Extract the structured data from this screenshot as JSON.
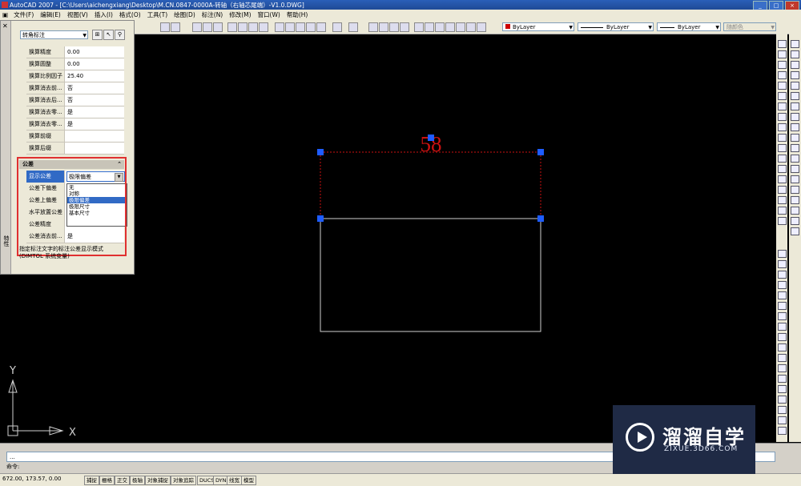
{
  "window": {
    "title": "AutoCAD 2007 - [C:\\Users\\aichengxiang\\Desktop\\M.CN.0847-0000A-转轴（右轴芯尾端）-V1.0.DWG]",
    "min": "_",
    "max": "□",
    "close": "×"
  },
  "menu": [
    "文件(F)",
    "编辑(E)",
    "视图(V)",
    "插入(I)",
    "格式(O)",
    "工具(T)",
    "绘图(D)",
    "标注(N)",
    "修改(M)",
    "窗口(W)",
    "帮助(H)"
  ],
  "toolbar": {
    "color": "ByLayer",
    "linetype": "ByLayer",
    "lineweight": "ByLayer",
    "plotstyle": "随颜色"
  },
  "properties": {
    "object_type": "转角标注",
    "rows": [
      {
        "k": "换算精度",
        "v": "0.00"
      },
      {
        "k": "换算圆整",
        "v": "0.00"
      },
      {
        "k": "换算比例因子",
        "v": "25.40"
      },
      {
        "k": "换算消去前...",
        "v": "否"
      },
      {
        "k": "换算消去后...",
        "v": "否"
      },
      {
        "k": "换算消去零...",
        "v": "是"
      },
      {
        "k": "换算消去零...",
        "v": "是"
      },
      {
        "k": "换算前缀",
        "v": ""
      },
      {
        "k": "换算后缀",
        "v": ""
      }
    ],
    "tolerance": {
      "header": "公差",
      "chevron": "⌃",
      "rows": [
        {
          "k": "显示公差",
          "v": ""
        },
        {
          "k": "公差下偏差",
          "v": ""
        },
        {
          "k": "公差上偏差",
          "v": ""
        },
        {
          "k": "水平放置公差",
          "v": ""
        },
        {
          "k": "公差精度",
          "v": "0.000"
        },
        {
          "k": "公差消去前...",
          "v": "是"
        }
      ],
      "selected": "极限偏差",
      "options": [
        "无",
        "对称",
        "极限偏差",
        "极限尺寸",
        "基本尺寸"
      ],
      "selected_index": 2
    },
    "description": "指定标注文字的标注公差显示模式",
    "sysvar": "(DIMTOL 系统变量)",
    "side_label": "特性"
  },
  "drawing": {
    "dimension_text": "58",
    "ucs_x": "X",
    "ucs_y": "Y"
  },
  "command": {
    "history": "...",
    "prompt": "命令:"
  },
  "status": {
    "coords": "672.00, 173.57, 0.00",
    "buttons": [
      "捕捉",
      "栅格",
      "正交",
      "极轴",
      "对象捕捉",
      "对象追踪",
      "DUCS",
      "DYN",
      "线宽",
      "模型"
    ]
  },
  "watermark": {
    "text": "溜溜自学",
    "url": "ZIXUE.3D66.COM"
  },
  "colors": {
    "background": "#000000",
    "selection_grip": "#1e5cff",
    "dimension": "#cc1111",
    "redbox": "#e03030",
    "highlight": "#316ac5"
  }
}
